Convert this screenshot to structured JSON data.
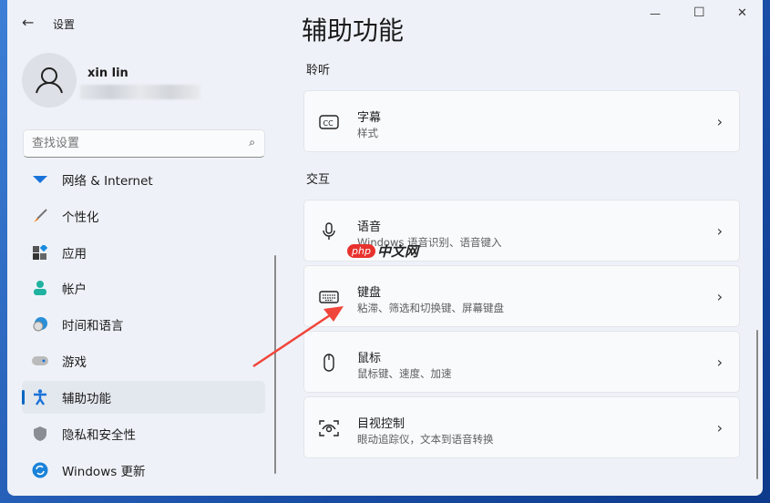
{
  "window": {
    "app_title": "设置",
    "controls": {
      "minimize": "—",
      "maximize": "☐",
      "close": "✕"
    }
  },
  "user": {
    "name": "xin lin"
  },
  "search": {
    "placeholder": "查找设置"
  },
  "sidebar": {
    "items": [
      {
        "label": "网络 & Internet",
        "icon": "wifi-icon"
      },
      {
        "label": "个性化",
        "icon": "brush-icon"
      },
      {
        "label": "应用",
        "icon": "apps-icon"
      },
      {
        "label": "帐户",
        "icon": "account-icon"
      },
      {
        "label": "时间和语言",
        "icon": "time-language-icon"
      },
      {
        "label": "游戏",
        "icon": "gamepad-icon"
      },
      {
        "label": "辅助功能",
        "icon": "accessibility-icon",
        "selected": true
      },
      {
        "label": "隐私和安全性",
        "icon": "shield-icon"
      },
      {
        "label": "Windows 更新",
        "icon": "update-icon"
      }
    ]
  },
  "main": {
    "title": "辅助功能",
    "sections": [
      {
        "label": "聆听",
        "cards": [
          {
            "title": "字幕",
            "subtitle": "样式",
            "icon": "captions-icon"
          }
        ]
      },
      {
        "label": "交互",
        "cards": [
          {
            "title": "语音",
            "subtitle": "Windows 语音识别、语音键入",
            "icon": "microphone-icon"
          },
          {
            "title": "键盘",
            "subtitle": "粘滞、筛选和切换键、屏幕键盘",
            "icon": "keyboard-icon"
          },
          {
            "title": "鼠标",
            "subtitle": "鼠标键、速度、加速",
            "icon": "mouse-icon"
          },
          {
            "title": "目视控制",
            "subtitle": "眼动追踪仪，文本到语音转换",
            "icon": "eye-control-icon"
          }
        ]
      }
    ]
  },
  "watermark": {
    "brand": "php",
    "text": "中文网"
  },
  "colors": {
    "accent": "#0067c0",
    "arrow": "#f0453a"
  }
}
